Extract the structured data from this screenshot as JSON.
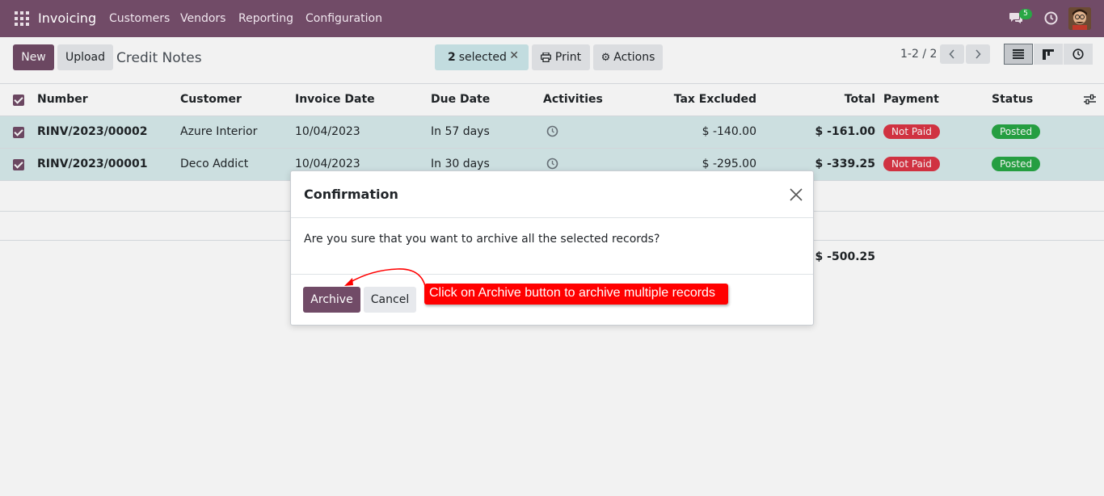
{
  "navbar": {
    "app_title": "Invoicing",
    "menu": [
      "Customers",
      "Vendors",
      "Reporting",
      "Configuration"
    ],
    "chat_badge": "5"
  },
  "control_panel": {
    "new_label": "New",
    "upload_label": "Upload",
    "breadcrumb": "Credit Notes",
    "selected_count": "2",
    "selected_text": "selected",
    "print_label": "Print",
    "actions_label": "Actions",
    "pager": "1-2 / 2"
  },
  "table": {
    "headers": {
      "number": "Number",
      "customer": "Customer",
      "invoice_date": "Invoice Date",
      "due_date": "Due Date",
      "activities": "Activities",
      "tax_excluded": "Tax Excluded",
      "total": "Total",
      "payment": "Payment",
      "status": "Status"
    },
    "rows": [
      {
        "number": "RINV/2023/00002",
        "customer": "Azure Interior",
        "invoice_date": "10/04/2023",
        "due_date": "In 57 days",
        "tax_excluded": "$ -140.00",
        "total": "$ -161.00",
        "payment": "Not Paid",
        "status": "Posted"
      },
      {
        "number": "RINV/2023/00001",
        "customer": "Deco Addict",
        "invoice_date": "10/04/2023",
        "due_date": "In 30 days",
        "tax_excluded": "$ -295.00",
        "total": "$ -339.25",
        "payment": "Not Paid",
        "status": "Posted"
      }
    ],
    "footer_total": "$ -500.25"
  },
  "modal": {
    "title": "Confirmation",
    "body": "Are you sure that you want to archive all the selected records?",
    "archive_label": "Archive",
    "cancel_label": "Cancel"
  },
  "annotation": {
    "text": "Click on Archive button to archive multiple records"
  },
  "colors": {
    "brand": "#714b67",
    "selected_row": "#d7ebec",
    "not_paid": "#dc3545",
    "posted": "#28a745",
    "annotation": "#ff0000"
  }
}
